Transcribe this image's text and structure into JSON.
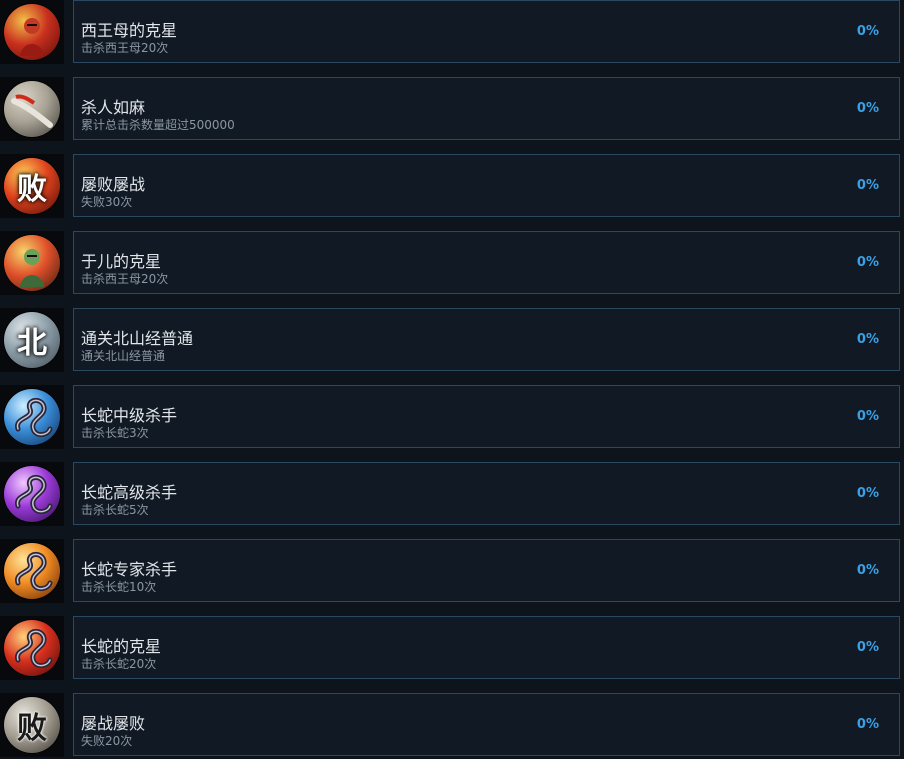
{
  "achievements": [
    {
      "title": "西王母的克星",
      "desc": "击杀西王母20次",
      "pct": "0%",
      "icon": "queen-mother-portrait-icon",
      "colors": [
        "#f2c04a",
        "#c8301e",
        "#5a0c08"
      ],
      "glyph": ""
    },
    {
      "title": "杀人如麻",
      "desc": "累计总击杀数量超过500000",
      "pct": "0%",
      "icon": "crossed-blades-icon",
      "colors": [
        "#d9d4c8",
        "#a8a294",
        "#3c3a36"
      ],
      "glyph": ""
    },
    {
      "title": "屡败屡战",
      "desc": "失败30次",
      "pct": "0%",
      "icon": "defeat-calligraphy-icon",
      "colors": [
        "#ffcf5a",
        "#e0431e",
        "#4a0a06"
      ],
      "glyph": "败"
    },
    {
      "title": "于儿的克星",
      "desc": "击杀西王母20次",
      "pct": "0%",
      "icon": "yuer-deity-portrait-icon",
      "colors": [
        "#f6d36a",
        "#e0502a",
        "#3b1a10"
      ],
      "glyph": ""
    },
    {
      "title": "通关北山经普通",
      "desc": "通关北山经普通",
      "pct": "0%",
      "icon": "north-mountain-calligraphy-icon",
      "colors": [
        "#dfe6ea",
        "#8ea0aa",
        "#3b4650"
      ],
      "glyph": "北"
    },
    {
      "title": "长蛇中级杀手",
      "desc": "击杀长蛇3次",
      "pct": "0%",
      "icon": "serpent-blue-icon",
      "colors": [
        "#cdeeff",
        "#3a8ed8",
        "#0b2a58"
      ],
      "glyph": ""
    },
    {
      "title": "长蛇高级杀手",
      "desc": "击杀长蛇5次",
      "pct": "0%",
      "icon": "serpent-purple-icon",
      "colors": [
        "#f0c8ff",
        "#9a3ad8",
        "#2a0b48"
      ],
      "glyph": ""
    },
    {
      "title": "长蛇专家杀手",
      "desc": "击杀长蛇10次",
      "pct": "0%",
      "icon": "serpent-orange-icon",
      "colors": [
        "#ffe39a",
        "#f08a22",
        "#5a2408"
      ],
      "glyph": ""
    },
    {
      "title": "长蛇的克星",
      "desc": "击杀长蛇20次",
      "pct": "0%",
      "icon": "serpent-red-icon",
      "colors": [
        "#ffd07a",
        "#d8301e",
        "#4a0808"
      ],
      "glyph": ""
    },
    {
      "title": "屡战屡败",
      "desc": "失败20次",
      "pct": "0%",
      "icon": "defeat-calligraphy-gray-icon",
      "colors": [
        "#e6e2da",
        "#a49e92",
        "#3a3630"
      ],
      "glyph": "败"
    }
  ]
}
